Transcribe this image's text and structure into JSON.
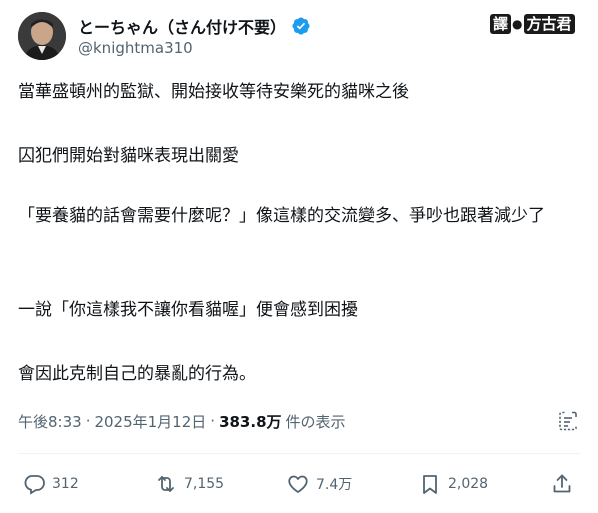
{
  "author": {
    "display_name": "とーちゃん（さん付け不要）",
    "handle": "@knightma310",
    "verified": true
  },
  "watermark": {
    "chip1": "譯",
    "chip2": "方古君"
  },
  "tweet": {
    "paragraphs": [
      "當華盛頓州的監獄、開始接收等待安樂死的貓咪之後",
      "囚犯們開始對貓咪表現出關愛",
      "「要養貓的話會需要什麼呢？」像這樣的交流變多、爭吵也跟著減少了",
      "一說「你這樣我不讓你看貓喔」便會感到困擾",
      "會因此克制自己的暴亂的行為。"
    ]
  },
  "meta": {
    "time": "午後8:33",
    "separator1": "·",
    "date": "2025年1月12日",
    "separator2": "·",
    "views_count": "383.8万",
    "views_label": "件の表示"
  },
  "actions": {
    "reply_count": "312",
    "retweet_count": "7,155",
    "like_count": "7.4万",
    "bookmark_count": "2,028"
  },
  "icons": {
    "verified": "verified-badge-icon",
    "analytics": "analytics-icon",
    "reply": "reply-icon",
    "retweet": "retweet-icon",
    "like": "heart-icon",
    "bookmark": "bookmark-icon",
    "share": "share-icon"
  },
  "colors": {
    "verified_blue": "#1d9bf0",
    "text_primary": "#0f1419",
    "text_secondary": "#536471"
  }
}
